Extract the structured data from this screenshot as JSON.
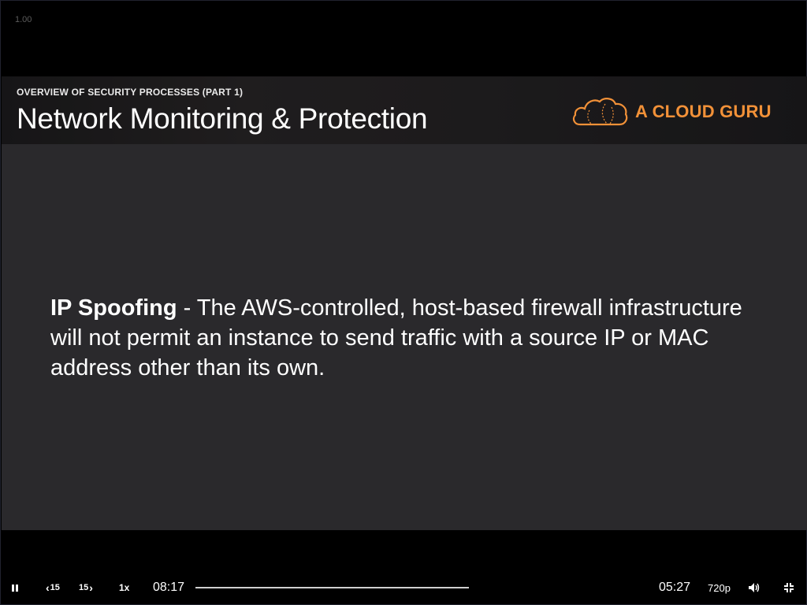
{
  "player": {
    "speed_indicator": "1.00",
    "controls": {
      "back_label": "15",
      "forward_label": "15",
      "rate": "1x",
      "elapsed": "08:17",
      "remaining": "05:27",
      "quality": "720p",
      "progress": 1.0,
      "icons": [
        "pause-icon",
        "skip-back-icon",
        "skip-forward-icon",
        "volume-icon",
        "exit-fullscreen-icon"
      ]
    }
  },
  "slide": {
    "section": "OVERVIEW OF SECURITY PROCESSES (PART 1)",
    "title": "Network Monitoring & Protection",
    "logo_text": "A CLOUD GURU",
    "term": "IP Spoofing",
    "body": " - The AWS-controlled, host-based firewall infrastructure will not permit an instance to send traffic with a source IP or MAC address other than its own.",
    "colors": {
      "accent": "#f29138",
      "background": "#2a292c"
    }
  }
}
